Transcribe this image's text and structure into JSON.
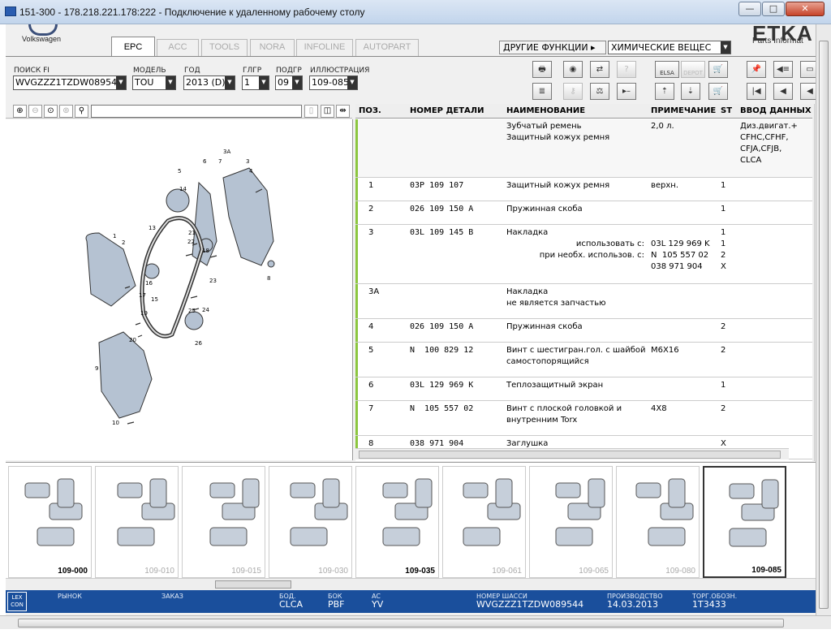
{
  "window": {
    "title": "151-300 - 178.218.221.178:222 - Подключение к удаленному рабочему столу",
    "min": "—",
    "max": "□",
    "close": "✕"
  },
  "brand": {
    "vw": "Volkswagen",
    "etka": "ETKA",
    "etka_sub": "Parts Informat"
  },
  "tabs": [
    {
      "label": "EPC"
    },
    {
      "label": "ACC"
    },
    {
      "label": "TOOLS"
    },
    {
      "label": "NORA"
    },
    {
      "label": "INFOLINE"
    },
    {
      "label": "AUTOPART"
    }
  ],
  "menu": {
    "other_functions": "ДРУГИЕ ФУНКЦИИ ▸",
    "chemicals": "ХИМИЧЕСКИЕ ВЕЩЕС"
  },
  "fields": {
    "search_fi": {
      "label": "ПОИСК FI",
      "value": "WVGZZZ1TZDW08954"
    },
    "model": {
      "label": "МОДЕЛЬ",
      "value": "TOU"
    },
    "year": {
      "label": "ГОД",
      "value": "2013 (D)"
    },
    "glgr": {
      "label": "ГЛГР",
      "value": "1"
    },
    "podgr": {
      "label": "ПОДГР",
      "value": "09"
    },
    "illustration": {
      "label": "ИЛЛЮСТРАЦИЯ",
      "value": "109-085"
    }
  },
  "toolbar": {
    "elsa": "ELSA",
    "depot": "DEPOT"
  },
  "table": {
    "headers": {
      "pos": "ПОЗ.",
      "part": "НОМЕР ДЕТАЛИ",
      "name": "НАИМЕНОВАНИЕ",
      "note": "ПРИМЕЧАНИЕ",
      "st": "ST",
      "input": "ВВОД ДАННЫХ П"
    },
    "header_row": {
      "name": "Зубчатый ремень\nЗащитный кожух ремня",
      "note": "2,0 л.",
      "input": "Диз.двигат.+\nCFHC,CFHF,\nCFJA,CFJB,\nCLCA"
    },
    "rows": [
      {
        "pos": "1",
        "part": "03P 109 107",
        "name": "Защитный кожух ремня",
        "note": "верхн.",
        "st": "1"
      },
      {
        "pos": "2",
        "part": "026 109 150 A",
        "name": "Пружинная скоба",
        "note": "",
        "st": "1"
      },
      {
        "pos": "3",
        "part": "03L 109 145 B",
        "name": "Накладка",
        "extra": "использовать с:\nпри необх. использов. с:",
        "note": "\n03L 129 969 K\nN  105 557 02\n038 971 904",
        "st": "1\n1\n2\nX"
      },
      {
        "pos": "3A",
        "part": "",
        "name": "Накладка\nне является запчастью",
        "note": "",
        "st": ""
      },
      {
        "pos": "4",
        "part": "026 109 150 A",
        "name": "Пружинная скоба",
        "note": "",
        "st": "2"
      },
      {
        "pos": "5",
        "part": "N  100 829 12",
        "name": "Винт с шестигран.гол. с шайбой\nсамостопорящийся",
        "note": "M6X16",
        "st": "2"
      },
      {
        "pos": "6",
        "part": "03L 129 969 K",
        "name": "Теплозащитный экран",
        "note": "",
        "st": "1"
      },
      {
        "pos": "7",
        "part": "N  105 557 02",
        "name": "Винт с плоской головкой и\nвнутренним Torx",
        "note": "4X8",
        "st": "2"
      },
      {
        "pos": "8",
        "part": "038 971 904",
        "name": "Заглушка",
        "note": "",
        "st": "X"
      }
    ]
  },
  "thumbnails": [
    {
      "label": "109-000",
      "bold": true
    },
    {
      "label": "109-010",
      "bold": false
    },
    {
      "label": "109-015",
      "bold": false
    },
    {
      "label": "109-030",
      "bold": false
    },
    {
      "label": "109-035",
      "bold": true
    },
    {
      "label": "109-061",
      "bold": false
    },
    {
      "label": "109-065",
      "bold": false
    },
    {
      "label": "109-080",
      "bold": false
    },
    {
      "label": "109-085",
      "bold": true
    }
  ],
  "status": {
    "lexcon": "LEX\nCON",
    "market": {
      "label": "РЫНОК",
      "value": ""
    },
    "order": {
      "label": "ЗАКАЗ",
      "value": ""
    },
    "bod": {
      "label": "БОД.",
      "value": "CLCA"
    },
    "bok": {
      "label": "БОК",
      "value": "PBF"
    },
    "ac": {
      "label": "AC",
      "value": "YV"
    },
    "chassis": {
      "label": "НОМЕР ШАССИ",
      "value": "WVGZZZ1TZDW089544"
    },
    "production": {
      "label": "ПРОИЗВОДСТВО",
      "value": "14.03.2013"
    },
    "trade": {
      "label": "ТОРГ.ОБОЗН.",
      "value": "1T3433"
    }
  },
  "diagram_labels": [
    "3A",
    "6",
    "7",
    "3",
    "4",
    "5",
    "14",
    "1",
    "2",
    "13",
    "21",
    "22",
    "18",
    "16",
    "15",
    "17",
    "19",
    "20",
    "23",
    "24",
    "25",
    "26",
    "9",
    "10",
    "8"
  ]
}
